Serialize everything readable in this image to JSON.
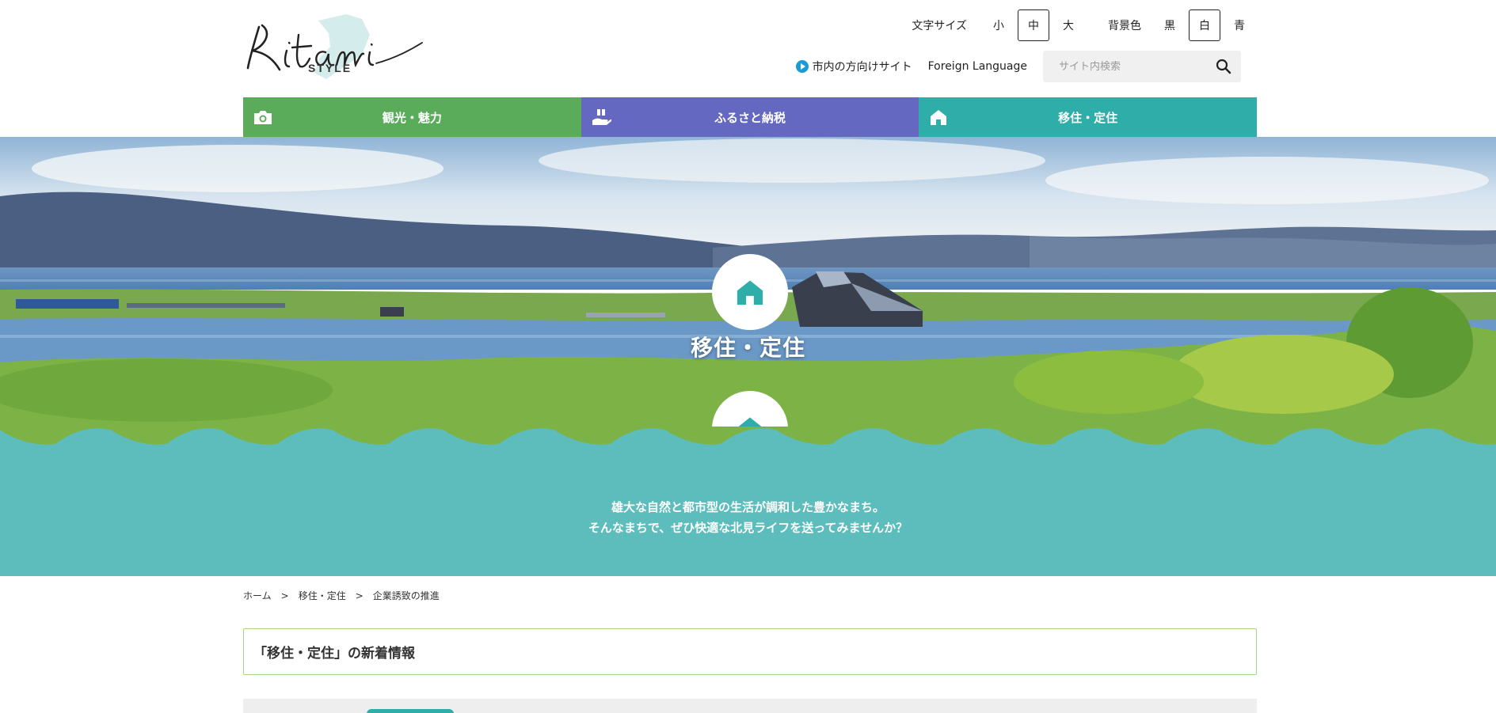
{
  "header": {
    "logo_text": "Kitami",
    "logo_sub": "STYLE"
  },
  "utility": {
    "font_size_label": "文字サイズ",
    "font_sizes": [
      "小",
      "中",
      "大"
    ],
    "bg_color_label": "背景色",
    "bg_colors": [
      "黒",
      "白",
      "青"
    ],
    "inner_site_link": "市内の方向けサイト",
    "foreign_language": "Foreign Language",
    "search_placeholder": "サイト内検索"
  },
  "nav": {
    "items": [
      {
        "label": "観光・魅力",
        "icon": "camera-icon",
        "color": "#5aab5a"
      },
      {
        "label": "ふるさと納税",
        "icon": "gift-hand-icon",
        "color": "#6468c1"
      },
      {
        "label": "移住・定住",
        "icon": "house-icon",
        "color": "#2fada9"
      }
    ]
  },
  "hero": {
    "title": "移住・定住",
    "icon": "house-icon",
    "tagline_line1": "雄大な自然と都市型の生活が調和した豊かなまち。",
    "tagline_line2": "そんなまちで、ぜひ快適な北見ライフを送ってみませんか？",
    "band_color": "#5cbdbc"
  },
  "breadcrumb": {
    "items": [
      "ホーム",
      "移住・定住",
      "企業誘致の推進"
    ],
    "separator": ">"
  },
  "news": {
    "heading": "「移住・定住」の新着情報"
  }
}
